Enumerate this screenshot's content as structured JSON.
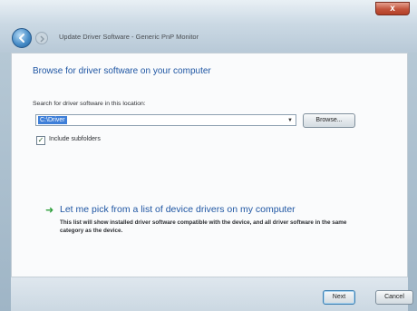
{
  "window": {
    "title": "Update Driver Software - Generic PnP Monitor",
    "close_label": "x"
  },
  "nav": {
    "back_icon": "back-arrow-icon",
    "forward_icon": "forward-arrow-icon"
  },
  "main": {
    "heading": "Browse for driver software on your computer",
    "search_label": "Search for driver software in this location:",
    "location_value": "C:\\Driver",
    "browse_label": "Browse...",
    "include_subfolders_label": "Include subfolders",
    "include_subfolders_checked": true,
    "pick_option_title": "Let me pick from a list of device drivers on my computer",
    "pick_option_desc": "This list will show installed driver software compatible with the device, and all driver software in the same category as the device."
  },
  "footer": {
    "next_label": "Next",
    "cancel_label": "Cancel"
  },
  "colors": {
    "link_blue": "#1f56a3",
    "selection_blue": "#3d7ed8",
    "arrow_green": "#2e9f3c"
  }
}
